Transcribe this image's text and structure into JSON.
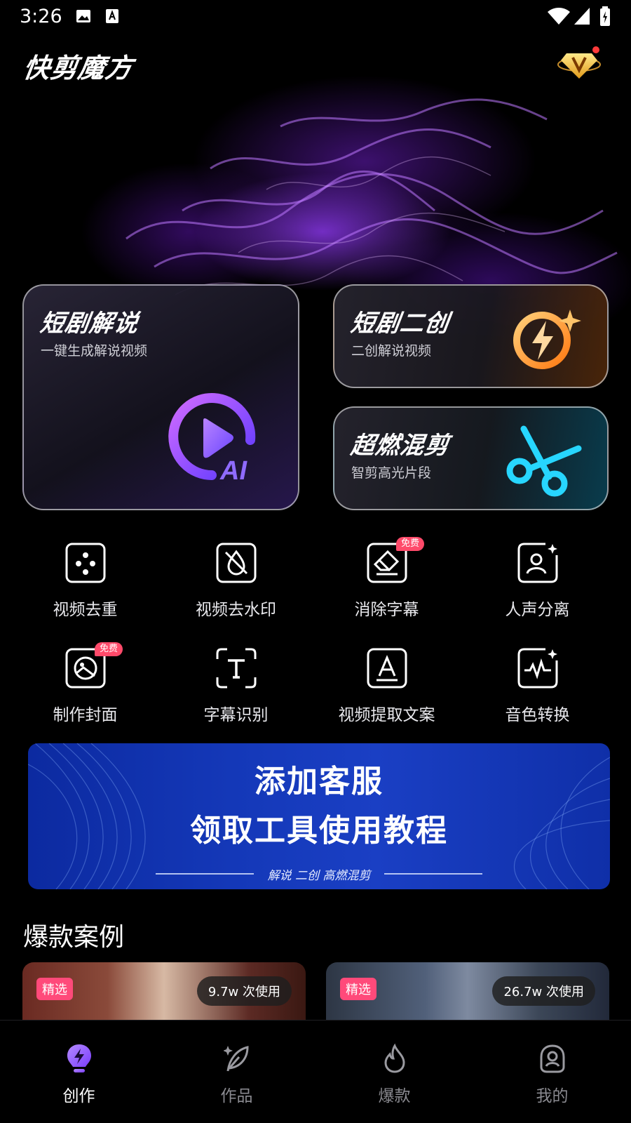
{
  "status_bar": {
    "time": "3:26",
    "icons": [
      "gallery-icon",
      "font-a-icon",
      "wifi-icon",
      "signal-icon",
      "battery-icon"
    ]
  },
  "header": {
    "app_title": "快剪魔方",
    "vip_icon": "vip-diamond-icon"
  },
  "feature_cards": [
    {
      "title": "短剧解说",
      "subtitle": "一键生成解说视频",
      "icon": "ai-play-icon"
    },
    {
      "title": "短剧二创",
      "subtitle": "二创解说视频",
      "icon": "lightning-sparkle-icon"
    },
    {
      "title": "超燃混剪",
      "subtitle": "智剪高光片段",
      "icon": "scissors-icon"
    }
  ],
  "tools": [
    {
      "label": "视频去重",
      "icon": "dice-icon",
      "badge": ""
    },
    {
      "label": "视频去水印",
      "icon": "no-watermark-icon",
      "badge": ""
    },
    {
      "label": "消除字幕",
      "icon": "eraser-icon",
      "badge": "免费"
    },
    {
      "label": "人声分离",
      "icon": "voice-separate-icon",
      "badge": ""
    },
    {
      "label": "制作封面",
      "icon": "cover-image-icon",
      "badge": "免费"
    },
    {
      "label": "字幕识别",
      "icon": "text-recognize-icon",
      "badge": ""
    },
    {
      "label": "视频提取文案",
      "icon": "extract-text-icon",
      "badge": ""
    },
    {
      "label": "音色转换",
      "icon": "voice-convert-icon",
      "badge": ""
    }
  ],
  "banner": {
    "line1": "添加客服",
    "line2": "领取工具使用教程",
    "tagline": "解说 二创 高燃混剪"
  },
  "section": {
    "title": "爆款案例"
  },
  "cases": [
    {
      "tag": "精选",
      "usage": "9.7w 次使用"
    },
    {
      "tag": "精选",
      "usage": "26.7w 次使用"
    }
  ],
  "bottom_nav": [
    {
      "label": "创作",
      "icon": "create-bolt-icon",
      "active": true
    },
    {
      "label": "作品",
      "icon": "works-leaf-icon",
      "active": false
    },
    {
      "label": "爆款",
      "icon": "flame-icon",
      "active": false
    },
    {
      "label": "我的",
      "icon": "profile-icon",
      "active": false
    }
  ],
  "colors": {
    "accent_purple": "#9b5cff",
    "free_badge": "#ff4a6a",
    "featured_tag": "#ff4a7a",
    "banner_blue": "#1438b8"
  }
}
